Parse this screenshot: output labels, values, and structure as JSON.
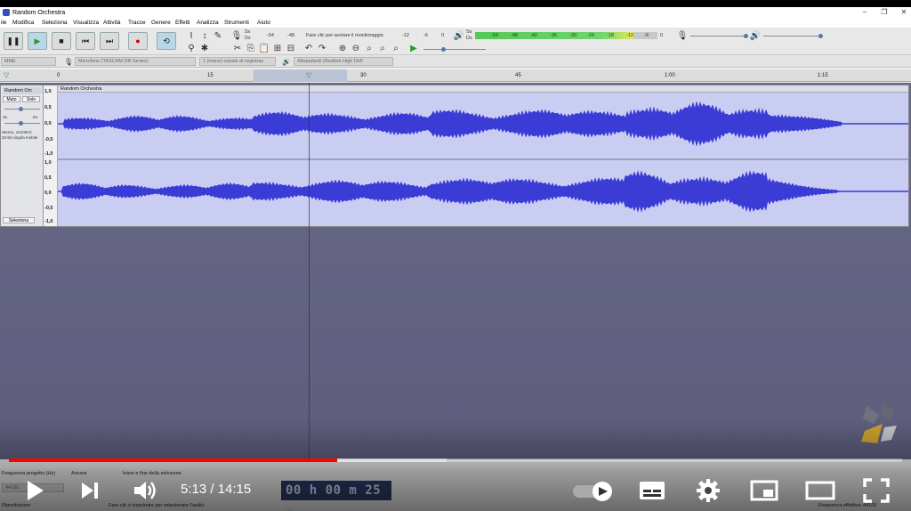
{
  "window": {
    "title": "Random Orchestra",
    "controls": [
      "–",
      "❐",
      "✕"
    ]
  },
  "menu": [
    "ile",
    "Modifica",
    "Seleziona",
    "Visualizza",
    "Attività",
    "Tracce",
    "Genere",
    "Effetti",
    "Analizza",
    "Strumenti",
    "Aiuto"
  ],
  "toolbar": {
    "monitor_hint": "Fare clic per avviare il monitoraggio",
    "meter_rec_scale": [
      "-54",
      "-48",
      "-12",
      "-6",
      "0"
    ],
    "meter_play_scale": [
      "-54",
      "-48",
      "-42",
      "-36",
      "-30",
      "-24",
      "-18",
      "-12",
      "-6",
      "0"
    ],
    "lr_label_top": "Sx",
    "lr_label_bottom": "Dx"
  },
  "devices": {
    "host": "MME",
    "mic": "Microfono (TASCAM DR Series)",
    "channels": "1 (mono) canale di registraz",
    "speakers": "Altoparlanti (Realtek High Defi"
  },
  "ruler": {
    "ticks": [
      "0",
      "15",
      "30",
      "45",
      "1:00",
      "1:15"
    ]
  },
  "track": {
    "name": "Random Orc",
    "clip_name": "Random Orchestra",
    "mute_label": "Muto",
    "solo_label": "Solo",
    "pan_left": "Sx",
    "pan_right": "Dx",
    "info_line1": "Stereo, 44100Hz",
    "info_line2": "32-bit virgola mobile",
    "select_label": "Seleziona",
    "y_labels_top": [
      "1,0",
      "0,5",
      "0,0",
      "-0,5",
      "-1,0"
    ],
    "y_labels_bottom": [
      "1,0",
      "0,5",
      "0,0",
      "-0,5",
      "-1,0"
    ]
  },
  "status": {
    "rate_label": "Frequenza progetto (Hz)",
    "rate_value": "44100",
    "snap_label": "Ancora",
    "selection_label": "Inizio e fine della selezione",
    "time_display": "00 h 00 m 25 s",
    "hint": "Fare clic e trascinare per selezionare l'audio",
    "stopped": "Riproduzione",
    "actual_rate": "Frequenza effettiva: 44100"
  },
  "player": {
    "time": "5:13 / 14:15",
    "played_fraction": 0.368,
    "buffered_fraction": 0.49,
    "accent": "#ff0000"
  }
}
